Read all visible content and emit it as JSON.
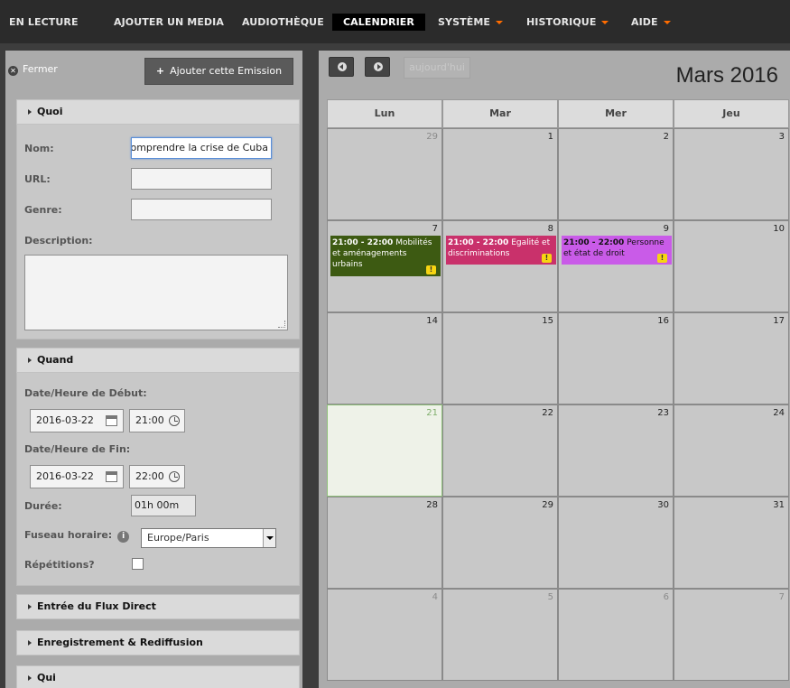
{
  "nav": {
    "items": [
      {
        "label": "EN LECTURE"
      },
      {
        "label": "AJOUTER UN MEDIA"
      },
      {
        "label": "AUDIOTHÈQUE"
      },
      {
        "label": "CALENDRIER"
      },
      {
        "label": "SYSTÈME"
      },
      {
        "label": "HISTORIQUE"
      },
      {
        "label": "AIDE"
      }
    ]
  },
  "form": {
    "close_label": "Fermer",
    "add_label": "Ajouter cette Emission",
    "quoi": {
      "title": "Quoi",
      "nom_label": "Nom:",
      "nom_value": "Comprendre la crise de Cuba",
      "url_label": "URL:",
      "url_value": "",
      "genre_label": "Genre:",
      "genre_value": "",
      "description_label": "Description:",
      "description_value": ""
    },
    "quand": {
      "title": "Quand",
      "start_label": "Date/Heure de Début:",
      "start_date": "2016-03-22",
      "start_time": "21:00",
      "end_label": "Date/Heure de Fin:",
      "end_date": "2016-03-22",
      "end_time": "22:00",
      "duration_label": "Durée:",
      "duration_value": "01h 00m",
      "timezone_label": "Fuseau horaire:",
      "timezone_value": "Europe/Paris",
      "repeat_label": "Répétitions?",
      "repeat_checked": false
    },
    "sections": [
      {
        "title": "Entrée du Flux Direct"
      },
      {
        "title": "Enregistrement & Rediffusion"
      },
      {
        "title": "Qui"
      }
    ]
  },
  "calendar": {
    "today_label": "aujourd'hui",
    "month_title": "Mars 2016",
    "weekdays": [
      "Lun",
      "Mar",
      "Mer",
      "Jeu"
    ],
    "weeks": [
      [
        "29",
        "1",
        "2",
        "3"
      ],
      [
        "7",
        "8",
        "9",
        "10"
      ],
      [
        "14",
        "15",
        "16",
        "17"
      ],
      [
        "21",
        "22",
        "23",
        "24"
      ],
      [
        "28",
        "29",
        "30",
        "31"
      ],
      [
        "4",
        "5",
        "6",
        "7"
      ]
    ],
    "events": [
      {
        "time": "21:00 - 22:00",
        "title": "Mobilités et aménagements urbains",
        "color": "#3d5a12",
        "warn": "!"
      },
      {
        "time": "21:00 - 22:00",
        "title": "Egalité et discriminations",
        "color": "#c9316b",
        "warn": "!"
      },
      {
        "time": "21:00 - 22:00",
        "title": "Personne et état de droit",
        "color": "#c95be8",
        "warn": "!"
      }
    ]
  }
}
